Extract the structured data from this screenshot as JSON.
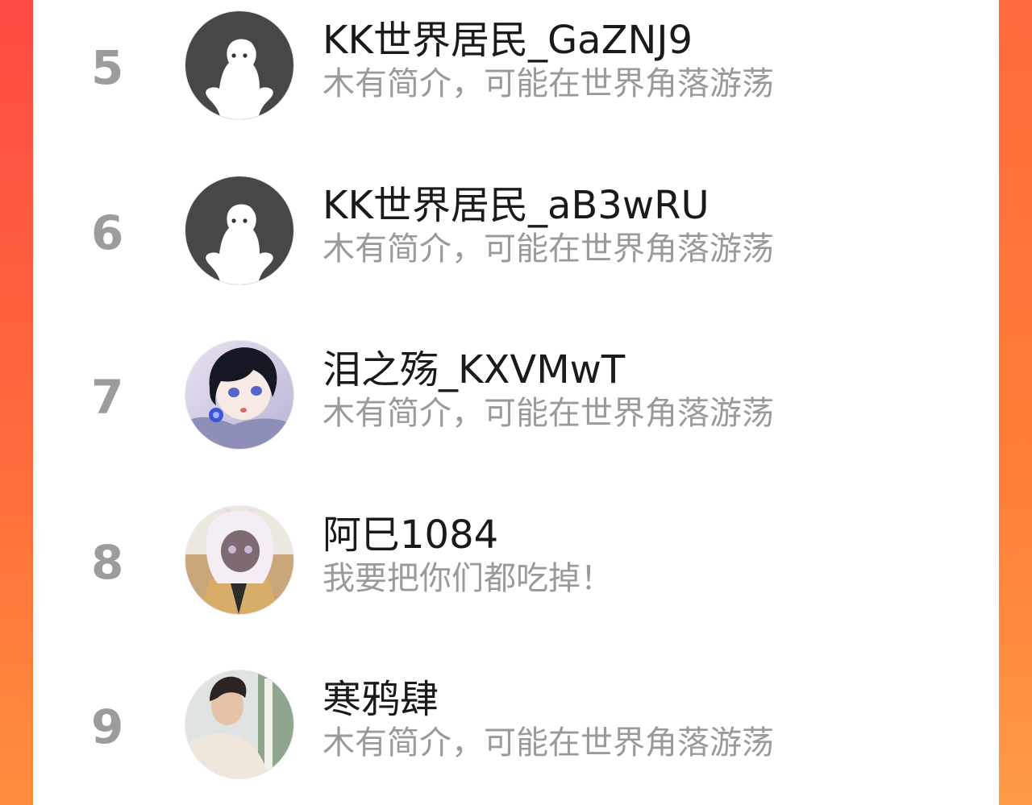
{
  "ranking": {
    "items": [
      {
        "rank": "5",
        "name": "KK世界居民_GaZNJ9",
        "bio": "木有简介，可能在世界角落游荡",
        "avatar": "default-ghost-avatar"
      },
      {
        "rank": "6",
        "name": "KK世界居民_aB3wRU",
        "bio": "木有简介，可能在世界角落游荡",
        "avatar": "default-ghost-avatar"
      },
      {
        "rank": "7",
        "name": "泪之殇_KXVMwT",
        "bio": "木有简介，可能在世界角落游荡",
        "avatar": "anime-boy-avatar"
      },
      {
        "rank": "8",
        "name": "阿巳1084",
        "bio": "我要把你们都吃掉！",
        "avatar": "anime-girl-avatar"
      },
      {
        "rank": "9",
        "name": "寒鸦肆",
        "bio": "木有简介，可能在世界角落游荡",
        "avatar": "photo-person-avatar"
      }
    ]
  },
  "colors": {
    "rank_text": "#9c9c9c",
    "name_text": "#1a1a1a",
    "bio_text": "#9a9a9a",
    "background_gradient_start": "#ff4a44",
    "background_gradient_end": "#ff8f3e"
  }
}
